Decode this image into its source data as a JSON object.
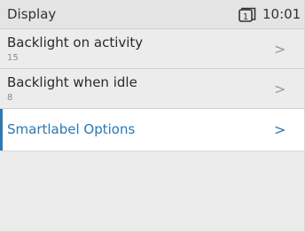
{
  "status": {
    "title": "Display",
    "phone_icon": "phone-line-1-icon",
    "line_number": "1",
    "time": "10:01"
  },
  "menu": {
    "items": [
      {
        "label": "Backlight on activity",
        "value": "15",
        "chevron": ">"
      },
      {
        "label": "Backlight when idle",
        "value": "8",
        "chevron": ">"
      },
      {
        "label": "Smartlabel Options",
        "chevron": ">"
      }
    ]
  },
  "colors": {
    "accent": "#2a78b3",
    "background": "#ececec",
    "header": "#e4e4e4",
    "selected_bg": "#ffffff"
  }
}
